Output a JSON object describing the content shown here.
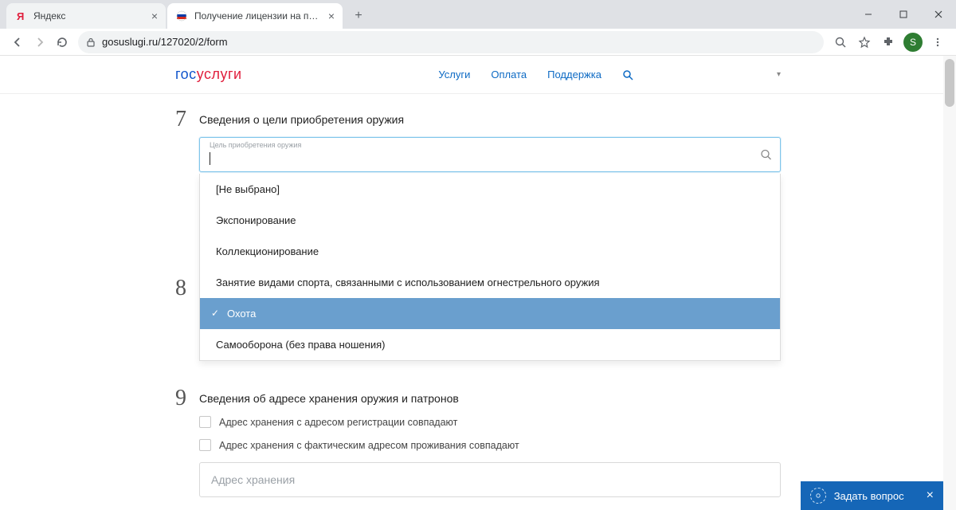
{
  "browser": {
    "tabs": [
      {
        "title": "Яндекс",
        "active": false
      },
      {
        "title": "Получение лицензии на приоб",
        "active": true
      }
    ],
    "url": "gosuslugi.ru/127020/2/form",
    "avatar_initial": "S"
  },
  "site": {
    "logo_parts": {
      "p1": "гос",
      "p2": "услуги"
    },
    "nav": {
      "services": "Услуги",
      "payment": "Оплата",
      "support": "Поддержка"
    }
  },
  "step7": {
    "num": "7",
    "title": "Сведения о цели приобретения оружия",
    "field_label": "Цель приобретения оружия",
    "options": [
      "[Не выбрано]",
      "Экспонирование",
      "Коллекционирование",
      "Занятие видами спорта, связанными с использованием огнестрельного оружия",
      "Охота",
      "Самооборона (без права ношения)"
    ],
    "selected_index": 4
  },
  "step8": {
    "num": "8"
  },
  "step9": {
    "num": "9",
    "title": "Сведения об адресе хранения оружия и патронов",
    "cb1": "Адрес хранения с адресом регистрации совпадают",
    "cb2": "Адрес хранения с фактическим адресом проживания совпадают",
    "address_placeholder": "Адрес хранения"
  },
  "ask": {
    "label": "Задать вопрос"
  }
}
